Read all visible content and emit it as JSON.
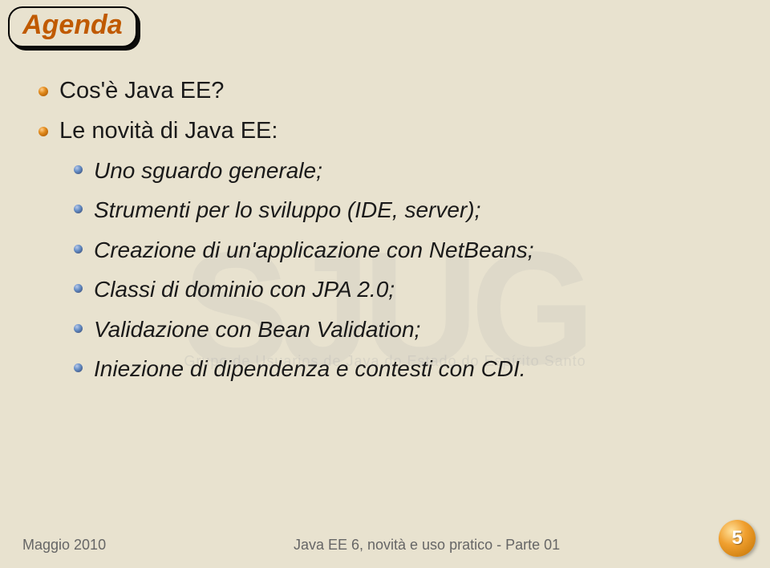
{
  "title": "Agenda",
  "items": {
    "main1": "Cos'è Java EE?",
    "main2": "Le novità di Java EE:",
    "sub": {
      "item1": "Uno sguardo generale;",
      "item2": "Strumenti per lo sviluppo (IDE, server);",
      "item3": "Creazione di un'applicazione con NetBeans;",
      "item4": "Classi di dominio con JPA 2.0;",
      "item5": "Validazione con Bean Validation;",
      "item6": "Iniezione di dipendenza e contesti con CDI."
    }
  },
  "watermark": {
    "logo": "SJUG",
    "tagline": "Grupo de Usuarios de Java do Estado do Espírito Santo"
  },
  "footer": {
    "left": "Maggio 2010",
    "center": "Java EE 6, novità e uso pratico - Parte 01"
  },
  "page": "5"
}
